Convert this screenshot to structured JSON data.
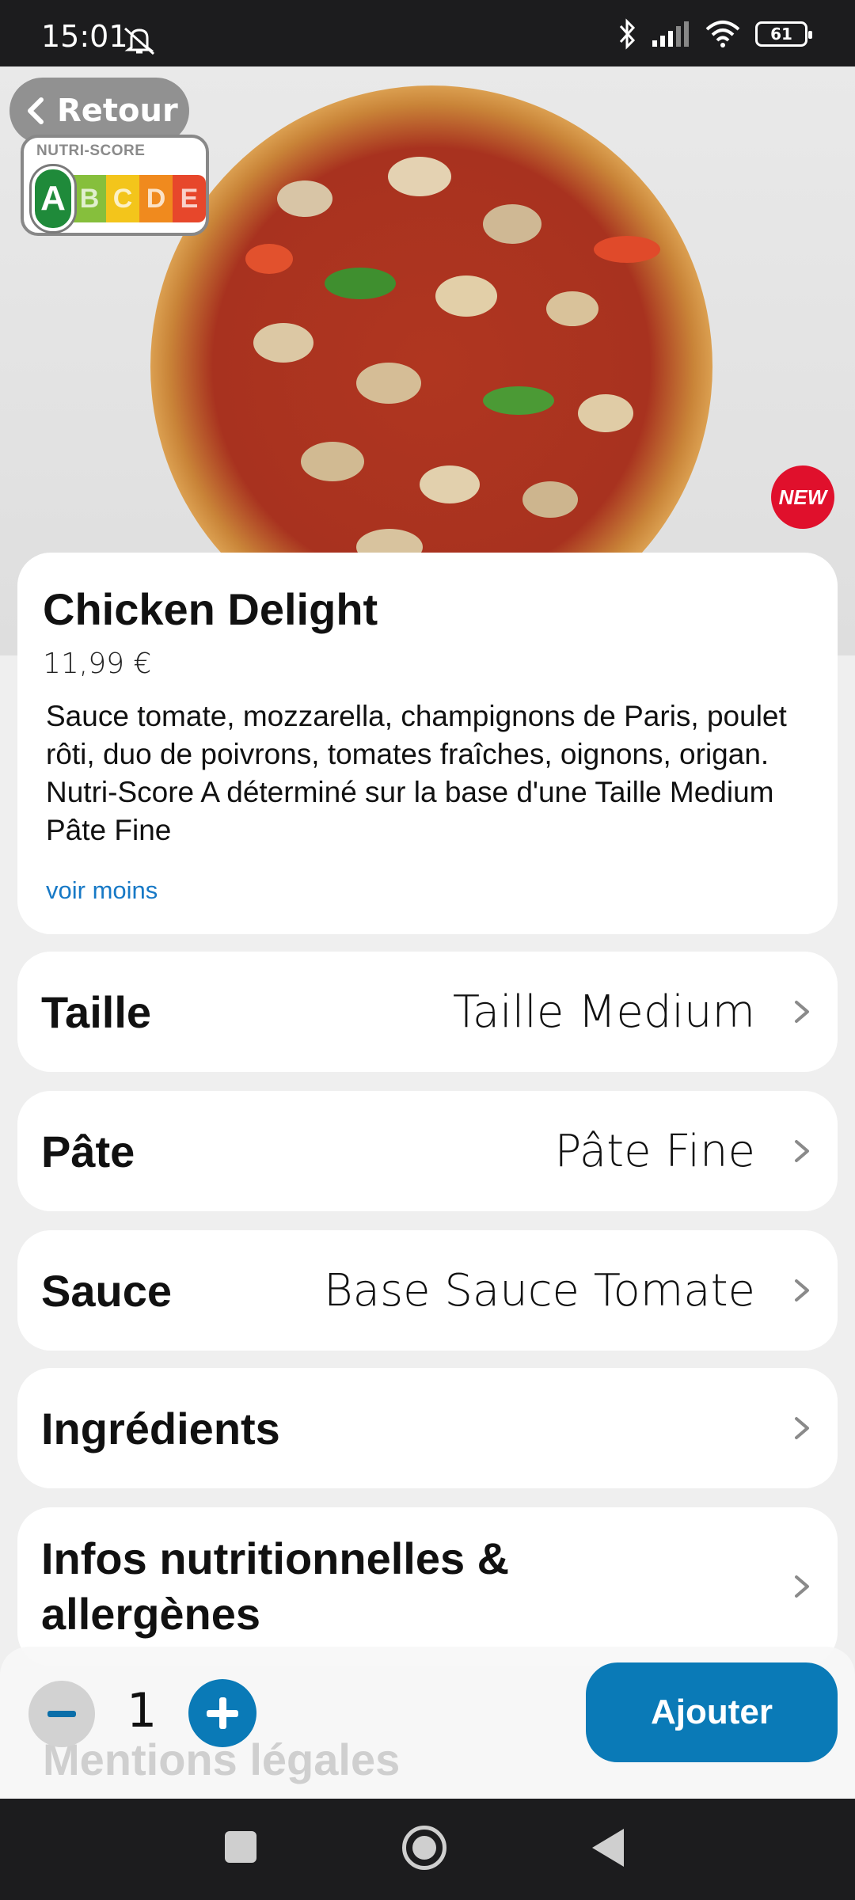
{
  "status_bar": {
    "time": "15:01",
    "battery": "61",
    "icons": [
      "mute-icon",
      "bluetooth-icon",
      "signal-icon",
      "wifi-icon",
      "battery-icon"
    ]
  },
  "header": {
    "back_label": "Retour",
    "nutri_title": "NUTRI-SCORE",
    "nutri_grades": [
      "A",
      "B",
      "C",
      "D",
      "E"
    ],
    "nutri_active": "A",
    "badge": "NEW"
  },
  "product": {
    "title": "Chicken Delight",
    "price": "11,99 €",
    "description": "Sauce tomate, mozzarella, champignons de Paris, poulet rôti, duo de poivrons, tomates fraîches, oignons, origan. Nutri-Score A déterminé sur la base d'une Taille Medium Pâte Fine",
    "toggle_label": "voir moins"
  },
  "options": [
    {
      "label": "Taille",
      "value": "Taille Medium"
    },
    {
      "label": "Pâte",
      "value": "Pâte Fine"
    },
    {
      "label": "Sauce",
      "value": "Base Sauce Tomate"
    },
    {
      "label": "Ingrédients",
      "value": ""
    },
    {
      "label": "Infos nutritionnelles & allergènes",
      "value": ""
    }
  ],
  "mentions_label": "Mentions légales",
  "cart": {
    "quantity": "1",
    "add_label": "Ajouter"
  },
  "colors": {
    "brand": "#0a7ab7",
    "link": "#1779c6",
    "badge": "#e0102c",
    "nutri_a": "#1f8a3a",
    "nutri_b": "#86bf3c",
    "nutri_c": "#f3c51b",
    "nutri_d": "#f08a1e",
    "nutri_e": "#e7472b"
  }
}
